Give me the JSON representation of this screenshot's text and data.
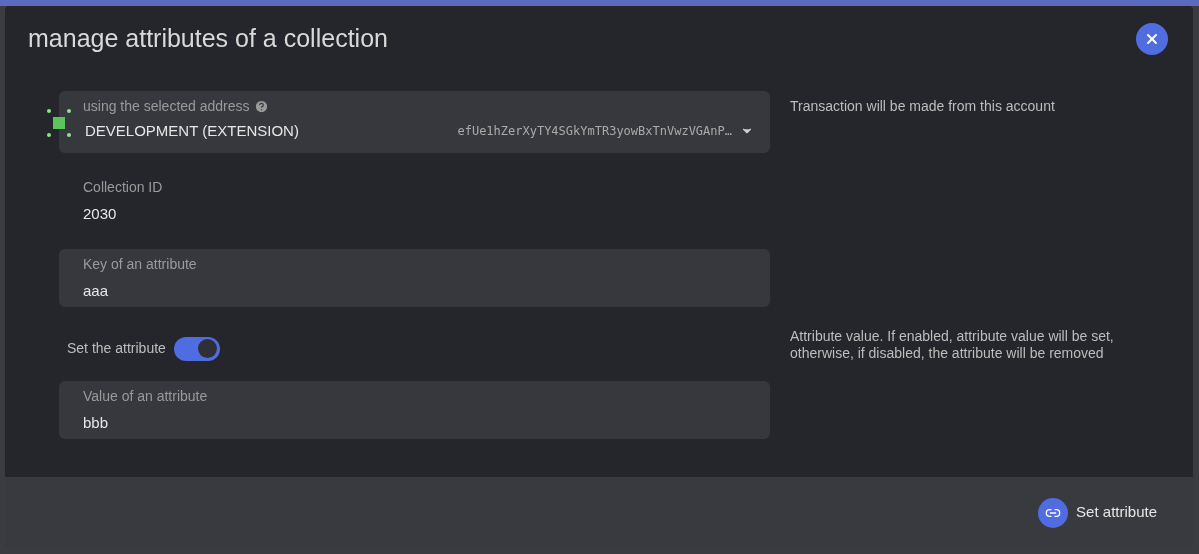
{
  "modal": {
    "title": "manage attributes of a collection"
  },
  "account": {
    "label": "using the selected address",
    "name": "DEVELOPMENT (EXTENSION)",
    "address": "efUe1hZerXyTY4SGkYmTR3yowBxTnVwzVGAnP…",
    "help": "Transaction will be made from this account"
  },
  "collection": {
    "label": "Collection ID",
    "value": "2030"
  },
  "key_field": {
    "label": "Key of an attribute",
    "value": "aaa"
  },
  "toggle": {
    "label": "Set the attribute",
    "on": true,
    "help": "Attribute value. If enabled, attribute value will be set, otherwise, if disabled, the attribute will be removed"
  },
  "value_field": {
    "label": "Value of an attribute",
    "value": "bbb"
  },
  "footer": {
    "button": "Set attribute"
  }
}
